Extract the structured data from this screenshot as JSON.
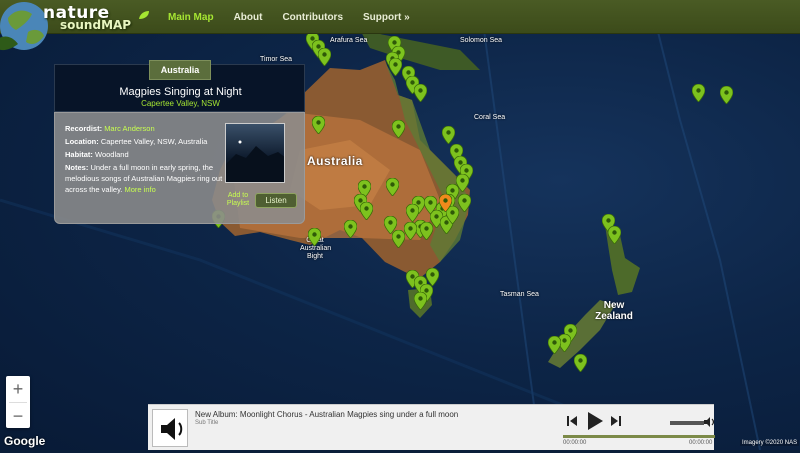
{
  "brand": {
    "line1": "nature",
    "line2": "soundMAP"
  },
  "nav": {
    "items": [
      {
        "label": "Main Map",
        "active": true
      },
      {
        "label": "About"
      },
      {
        "label": "Contributors"
      },
      {
        "label": "Support »"
      }
    ]
  },
  "map": {
    "labels": {
      "australia": "Australia",
      "new_zealand": "New\nZealand",
      "arafura_sea": "Arafura Sea",
      "timor_sea": "Timor Sea",
      "solomon_sea": "Solomon Sea",
      "coral_sea": "Coral Sea",
      "tasman_sea": "Tasman Sea",
      "great_australian_bight": "Great\nAustralian\nBight"
    },
    "pin_color": "#7dc21e",
    "selected_pin_color": "#f08a1c"
  },
  "info_panel": {
    "region_tab": "Australia",
    "title": "Magpies Singing at Night",
    "subtitle": "Capertee Valley, NSW",
    "recordist_label": "Recordist:",
    "recordist_value": "Marc Anderson",
    "location_label": "Location:",
    "location_value": "Capertee Valley, NSW, Australia",
    "habitat_label": "Habitat:",
    "habitat_value": "Woodland",
    "notes_label": "Notes:",
    "notes_value": "Under a full moon in early spring, the melodious songs of Australian Magpies ring out across the valley.",
    "more_info": "More info",
    "add_to_playlist": "Add to Playlist",
    "listen": "Listen"
  },
  "zoom": {
    "in": "+",
    "out": "−"
  },
  "google_logo": "Google",
  "imagery_credit": "Imagery ©2020 NAS",
  "player": {
    "track_title": "New Album: Moonlight Chorus - Australian Magpies sing under a full moon",
    "sub_title": "Sub Title",
    "time_current": "00:00:00",
    "time_total": "00:00:00"
  }
}
